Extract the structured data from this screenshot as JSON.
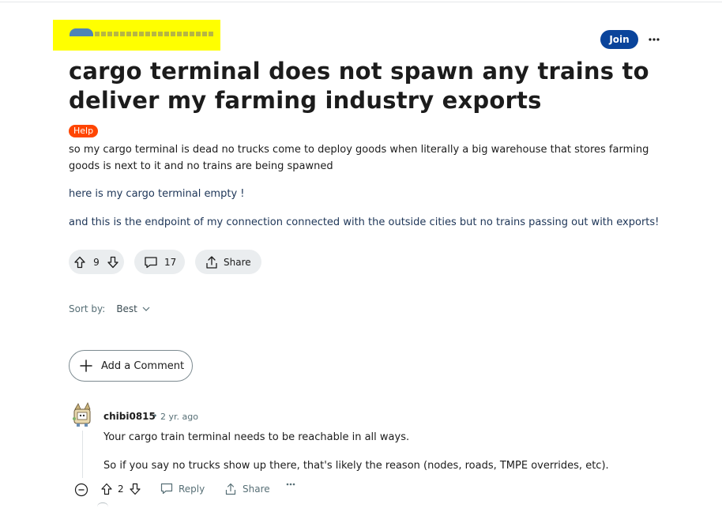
{
  "header": {
    "join_label": "Join"
  },
  "post": {
    "title": "cargo terminal does not spawn any trains to deliver my farming industry exports",
    "flair": "Help",
    "paragraphs": [
      "so my cargo terminal is dead no trucks come to deploy goods when literally a big warehouse that stores farming goods is next to it and no trains are being spawned",
      "here is my cargo terminal empty !",
      "and this is the endpoint of my connection connected with the outside cities but no trains passing out with exports!"
    ],
    "score": "9",
    "comments_count": "17",
    "share_label": "Share"
  },
  "sort": {
    "label": "Sort by:",
    "value": "Best"
  },
  "add_comment_label": "Add a Comment",
  "comments": [
    {
      "author": "chibi0815",
      "separator": "•",
      "time": "2 yr. ago",
      "lines": [
        "Your cargo train terminal needs to be reachable in all ways.",
        "So if you say no trucks show up there, that's likely the reason (nodes, roads, TMPE overrides, etc)."
      ],
      "score": "2",
      "reply_label": "Reply",
      "share_label": "Share"
    }
  ],
  "icons": {
    "upvote": "arrow-up-outline-icon",
    "downvote": "arrow-down-outline-icon",
    "comment": "speech-bubble-icon",
    "share": "share-upload-icon",
    "more": "ellipsis-icon",
    "add": "plus-icon",
    "collapse": "minus-circle-icon",
    "sort": "chevron-down-icon"
  },
  "colors": {
    "join_button": "#0a449b",
    "flair": "#ff4500",
    "pill_bg": "#eaedef",
    "redaction": "#ffff00"
  }
}
